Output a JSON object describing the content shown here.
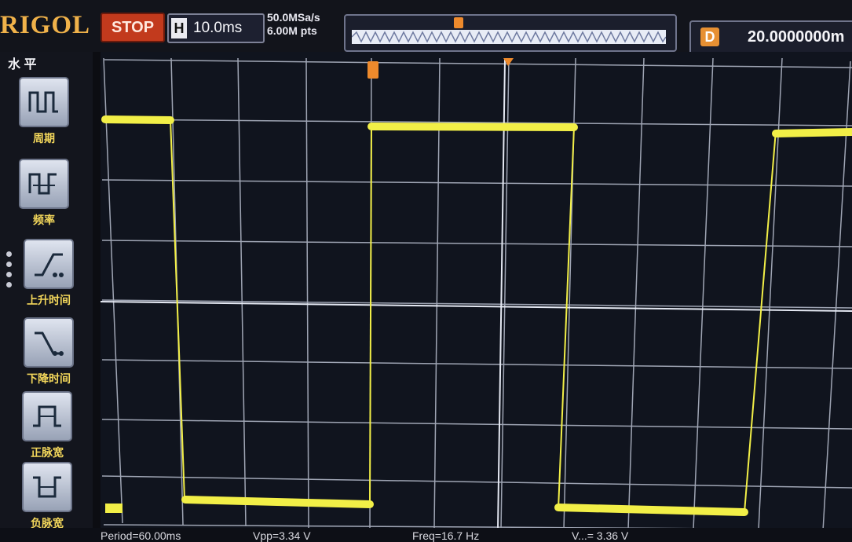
{
  "header": {
    "brand": "RIGOL",
    "run_state": "STOP",
    "timebase_prefix": "H",
    "timebase_value": "10.0ms",
    "sample_rate": "50.0MSa/s",
    "memory_depth": "6.00M pts",
    "delay_prefix": "D",
    "delay_value": "20.0000000m"
  },
  "sidebar": {
    "title": "水 平",
    "items": [
      {
        "label": "周期",
        "icon": "period-icon"
      },
      {
        "label": "频率",
        "icon": "frequency-icon"
      },
      {
        "label": "上升时间",
        "icon": "rise-time-icon"
      },
      {
        "label": "下降时间",
        "icon": "fall-time-icon"
      },
      {
        "label": "正脉宽",
        "icon": "positive-width-icon"
      },
      {
        "label": "负脉宽",
        "icon": "negative-width-icon"
      }
    ]
  },
  "measurements": {
    "period": "Period=60.00ms",
    "vpp": "Vpp=3.34 V",
    "freq": "Freq=16.7 Hz",
    "extra": "V...= 3.36 V"
  },
  "colors": {
    "trace": "#f2ef47",
    "grid": "#cfd6e6",
    "stop": "#c23a1d",
    "accent": "#ee8a2c"
  }
}
